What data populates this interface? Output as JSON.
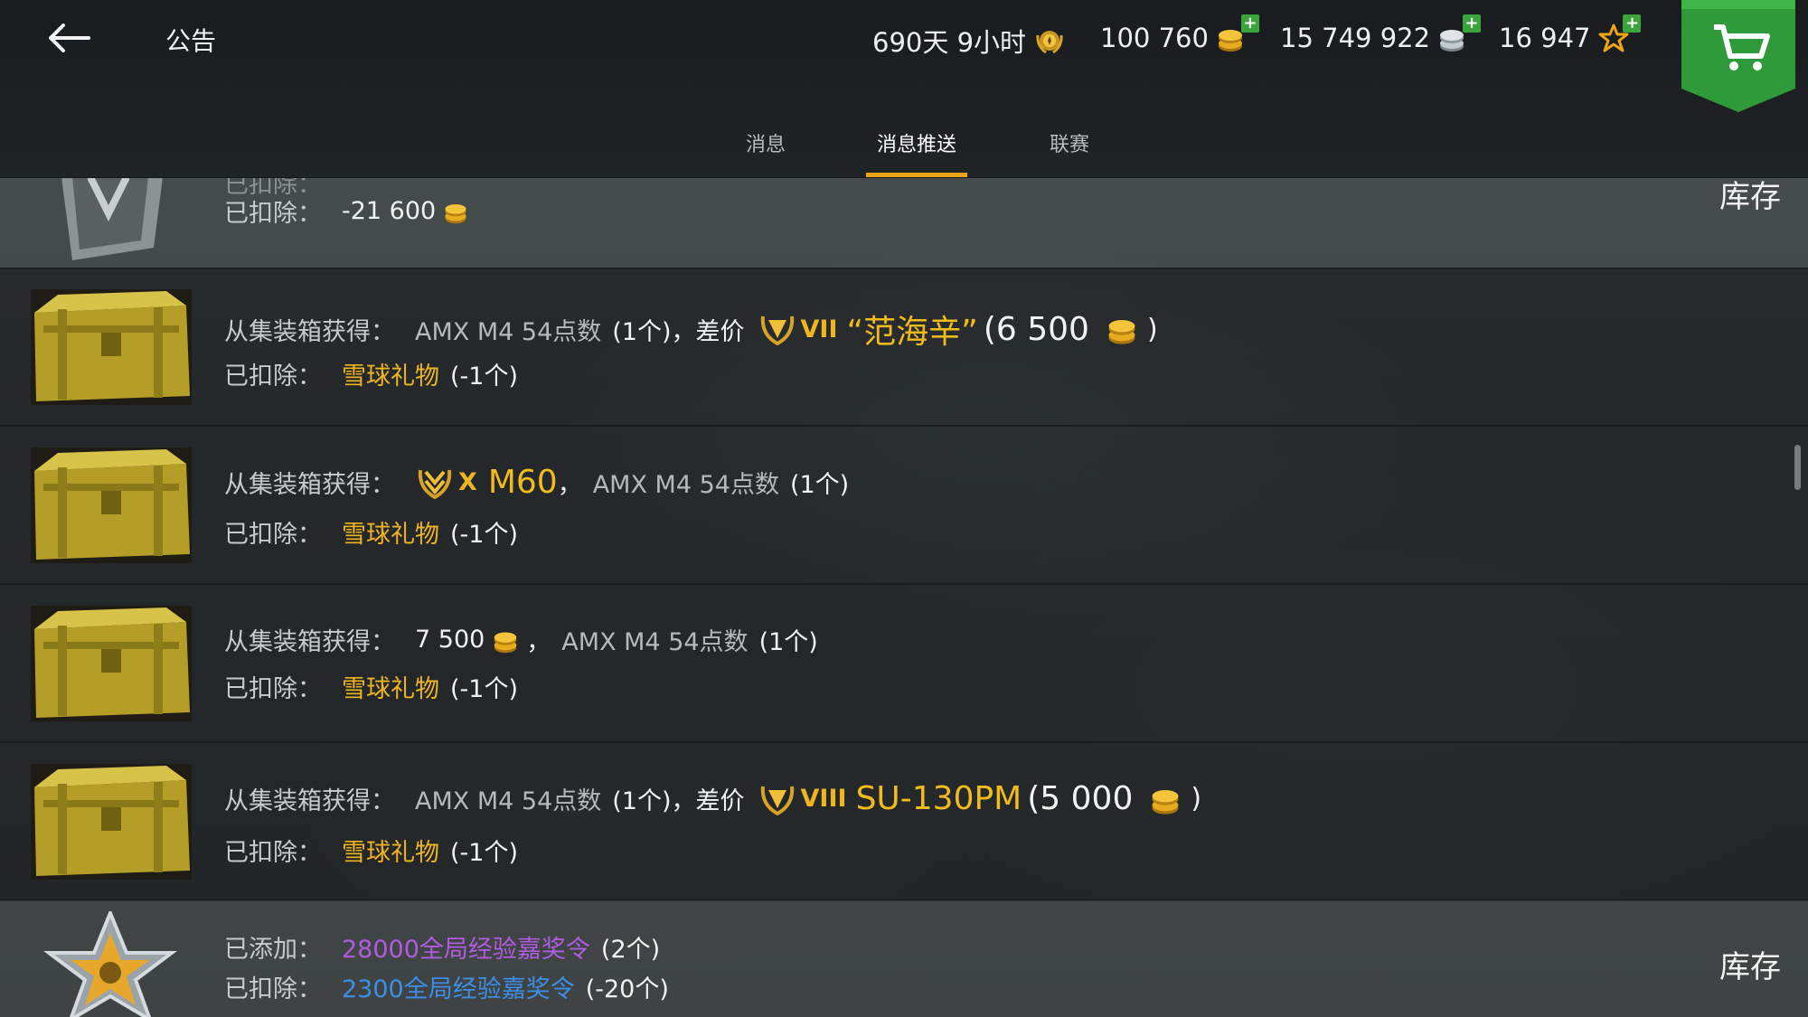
{
  "header": {
    "title": "公告",
    "resources": [
      {
        "value": "690天 9小时",
        "icon": "premium-laurel-icon"
      },
      {
        "value": "100 760",
        "icon": "gold-coin-icon"
      },
      {
        "value": "15 749 922",
        "icon": "silver-coin-icon"
      },
      {
        "value": "16 947",
        "icon": "free-xp-star-icon"
      }
    ],
    "plus": "+"
  },
  "tabs": [
    {
      "label": "消息"
    },
    {
      "label": "消息推送"
    },
    {
      "label": "联赛"
    }
  ],
  "list": {
    "row0": {
      "partial_text": "已扣除：",
      "deducted_label": "已扣除：",
      "deducted_value": "-21 600",
      "inventory": "库存"
    },
    "row1": {
      "label": "从集装箱获得：",
      "item": "AMX M4 54点数",
      "count": "(1个)",
      "sep": "，",
      "diff": "差价",
      "tier": "VII",
      "tank": "“范海辛”",
      "price_open": "(6 500",
      "price_close": ")",
      "deducted_label": "已扣除：",
      "deducted_item": "雪球礼物",
      "deducted_count": "(-1个)"
    },
    "row2": {
      "label": "从集装箱获得：",
      "tier": "X",
      "tank": "M60",
      "sep": "，",
      "item": "AMX M4 54点数",
      "count": "(1个)",
      "deducted_label": "已扣除：",
      "deducted_item": "雪球礼物",
      "deducted_count": "(-1个)"
    },
    "row3": {
      "label": "从集装箱获得：",
      "gold": "7 500",
      "sep": "，",
      "item": "AMX M4 54点数",
      "count": "(1个)",
      "deducted_label": "已扣除：",
      "deducted_item": "雪球礼物",
      "deducted_count": "(-1个)"
    },
    "row4": {
      "label": "从集装箱获得：",
      "item": "AMX M4 54点数",
      "count": "(1个)",
      "sep": "，",
      "diff": "差价",
      "tier": "VIII",
      "tank": "SU-130PM",
      "price_open": "(5 000",
      "price_close": ")",
      "deducted_label": "已扣除：",
      "deducted_item": "雪球礼物",
      "deducted_count": "(-1个)"
    },
    "row5": {
      "added_label": "已添加：",
      "added_item": "28000全局经验嘉奖令",
      "added_count": "(2个)",
      "deducted_label": "已扣除：",
      "deducted_item": "2300全局经验嘉奖令",
      "deducted_count": "(-20个)",
      "inventory": "库存"
    }
  },
  "colors": {
    "accent": "#f0a418",
    "gold_text": "#efb520",
    "purple_text": "#b05ce0",
    "blue_text": "#3c8fe6",
    "plus_green": "#3aa53a",
    "cart_green": "#2f9a3a"
  }
}
